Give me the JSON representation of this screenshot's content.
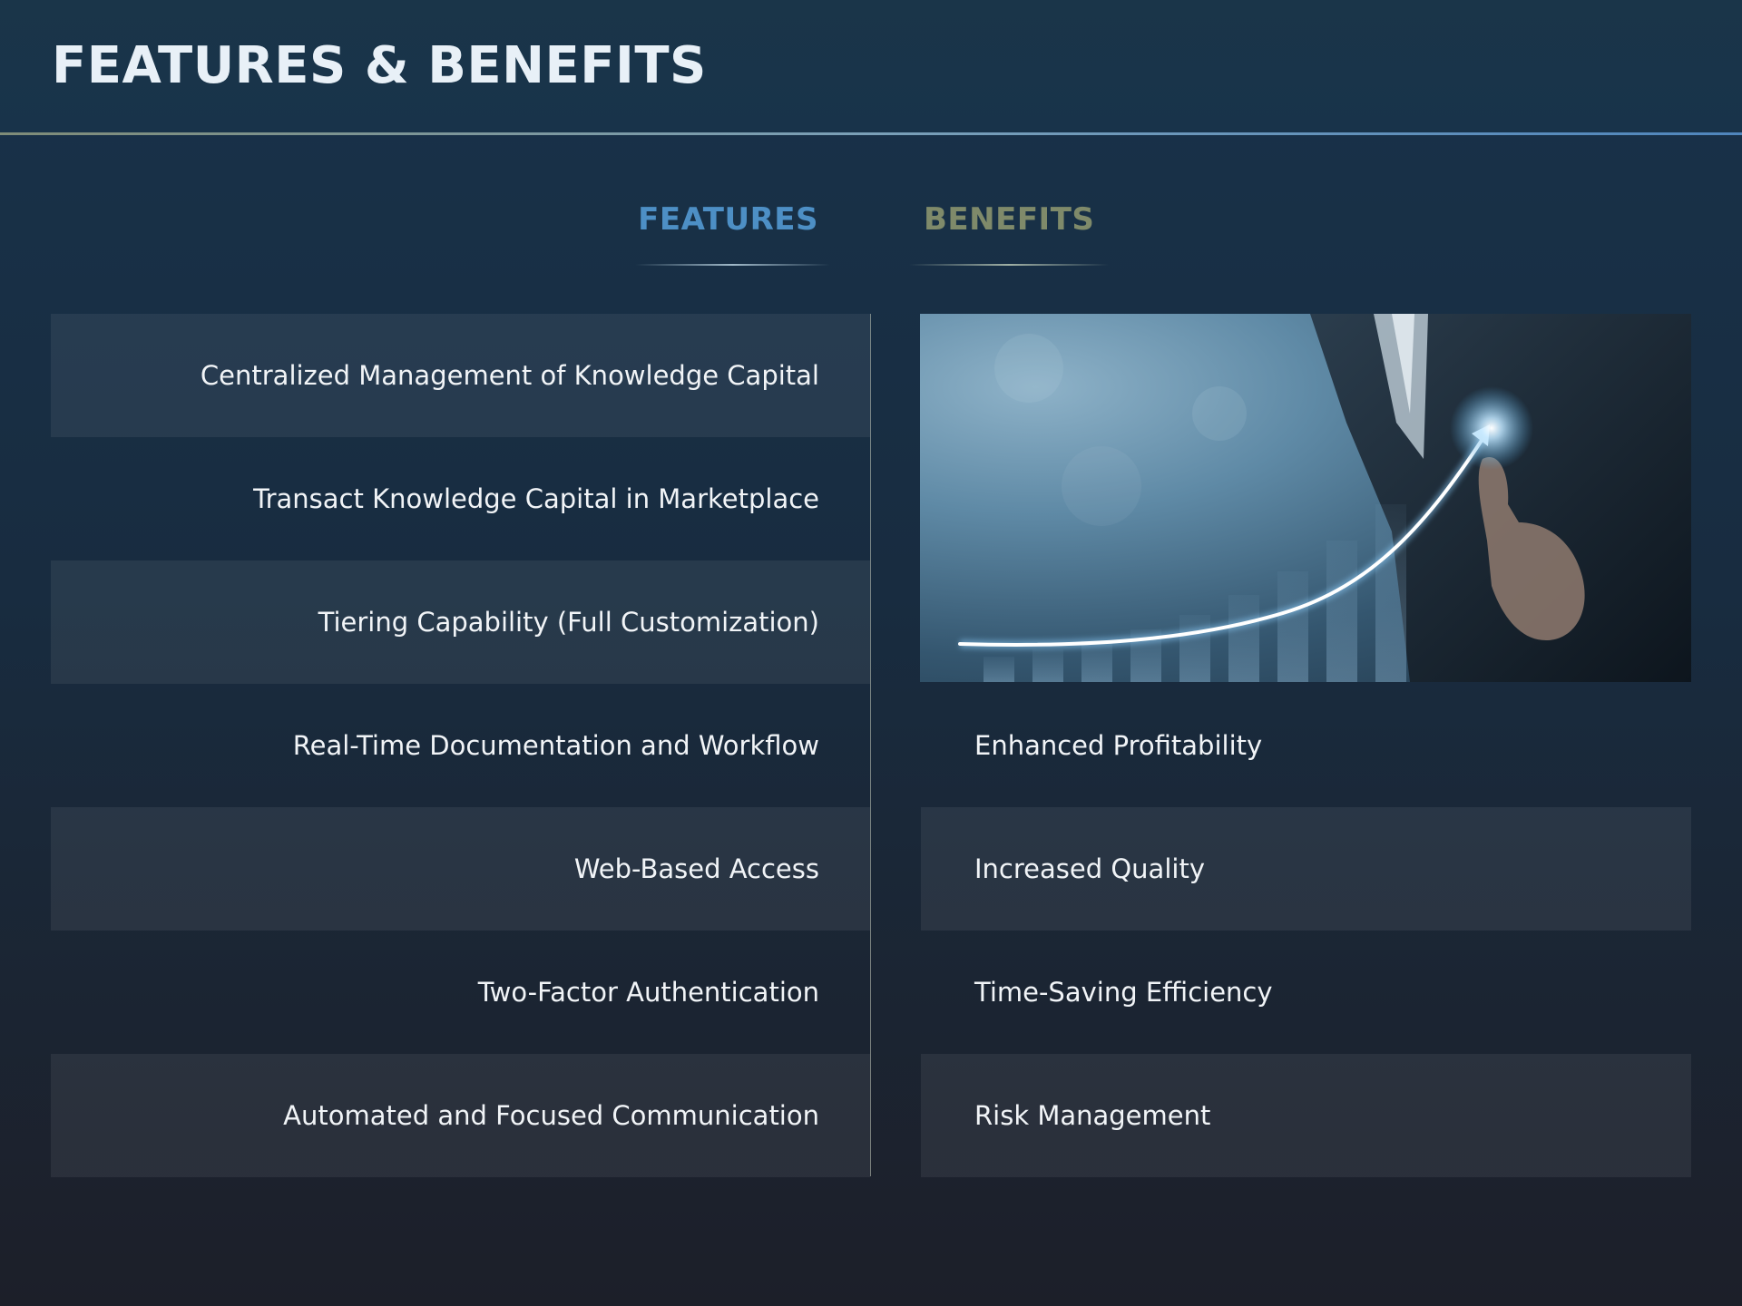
{
  "title": "FEATURES & BENEFITS",
  "columns": {
    "features": "FEATURES",
    "benefits": "BENEFITS"
  },
  "rows": [
    {
      "feature": "Centralized Management of Knowledge Capital",
      "benefit": ""
    },
    {
      "feature": "Transact Knowledge Capital in Marketplace",
      "benefit": ""
    },
    {
      "feature": "Tiering Capability (Full Customization)",
      "benefit": ""
    },
    {
      "feature": "Real-Time Documentation and Workflow",
      "benefit": "Enhanced Profitability"
    },
    {
      "feature": "Web-Based Access",
      "benefit": "Increased Quality"
    },
    {
      "feature": "Two-Factor Authentication",
      "benefit": "Time-Saving Efficiency"
    },
    {
      "feature": "Automated and Focused Communication",
      "benefit": "Risk Management"
    }
  ],
  "colors": {
    "features_header": "#4d8fc5",
    "benefits_header": "#7f8a6a",
    "background_top": "#18324a",
    "background_bottom": "#1c1f29"
  },
  "image": {
    "subject": "businessman-pointing-growth-arrow"
  }
}
